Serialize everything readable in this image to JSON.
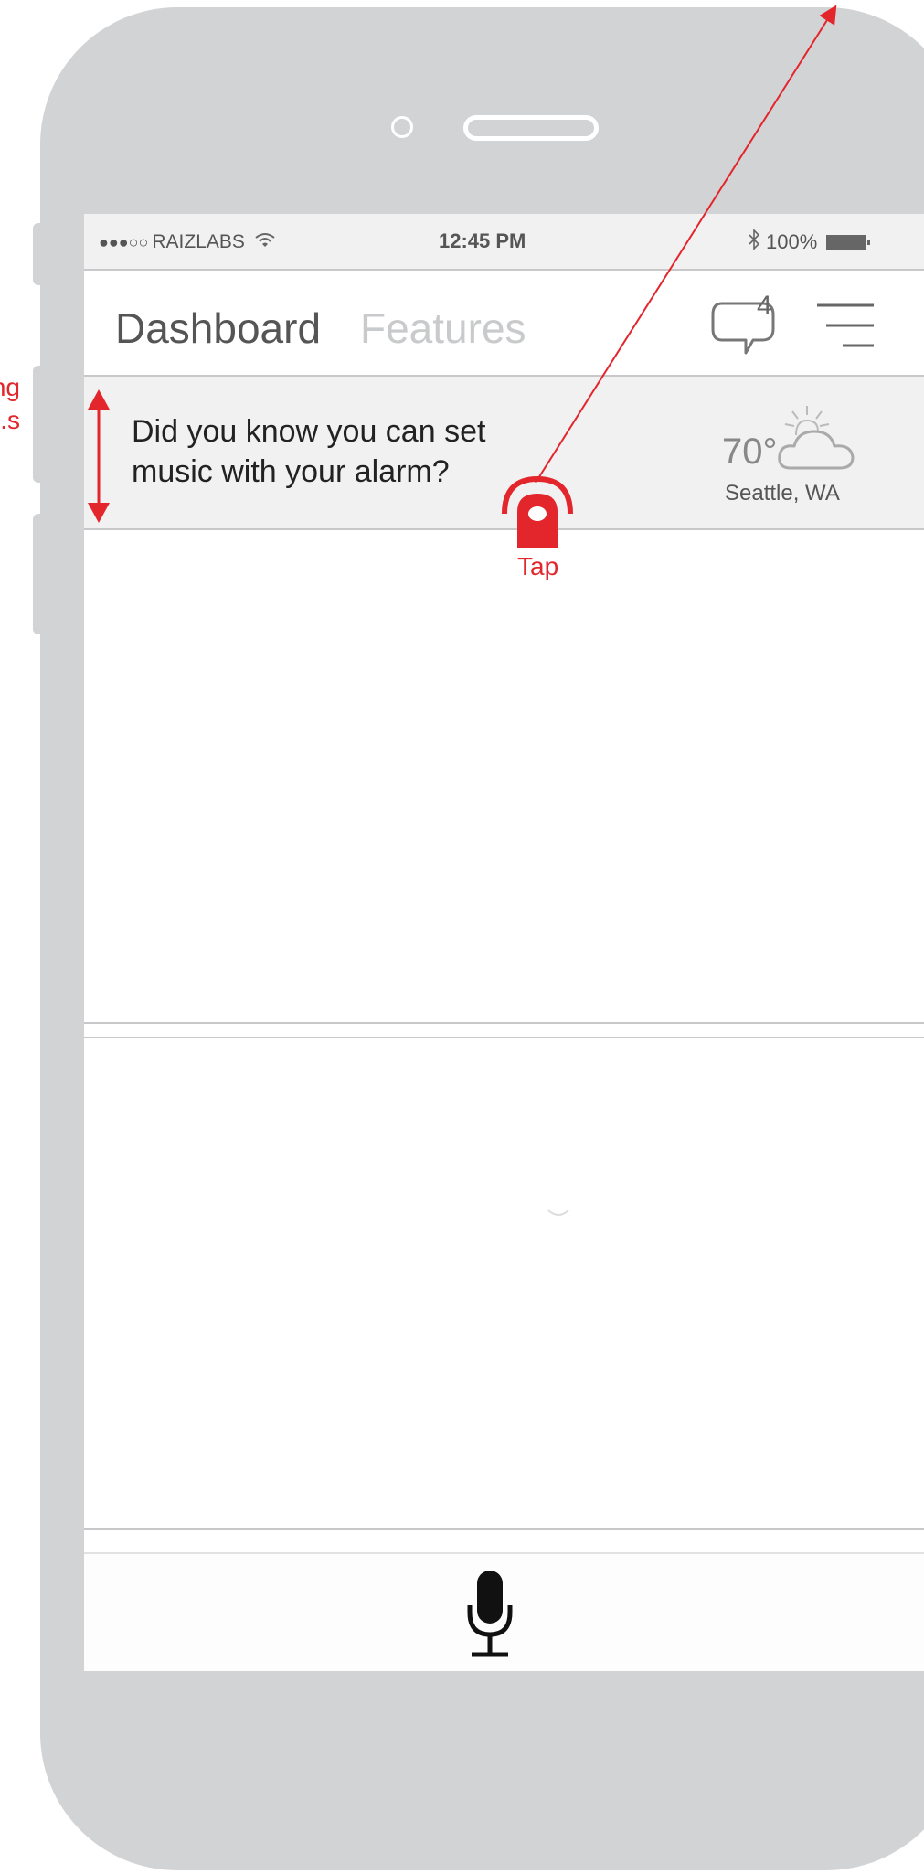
{
  "status_bar": {
    "signal": "●●●○○",
    "carrier": "RAIZLABS",
    "time": "12:45 PM",
    "bluetooth_icon": "bluetooth-icon",
    "battery": "100%"
  },
  "nav": {
    "tabs": [
      {
        "label": "Dashboard",
        "active": true
      },
      {
        "label": "Features",
        "active": false
      }
    ],
    "chat_count": "4",
    "chat_icon": "chat-bubble-icon",
    "menu_icon": "hamburger-menu-icon"
  },
  "tip": {
    "text_line1": "Did you know you can set",
    "text_line2": "music with your alarm?"
  },
  "weather": {
    "temperature": "70°",
    "location": "Seattle, WA",
    "icon": "partly-cloudy-icon"
  },
  "voice": {
    "icon": "microphone-icon"
  },
  "annotations": {
    "side_note": "ng\ns.",
    "tap_label": "Tap",
    "color": "#e3262c"
  },
  "colors": {
    "phone_body": "#d2d3d5",
    "status_bg": "#f1f1f2",
    "inactive_tab": "#c9cacc",
    "annotation_red": "#e3262c"
  }
}
